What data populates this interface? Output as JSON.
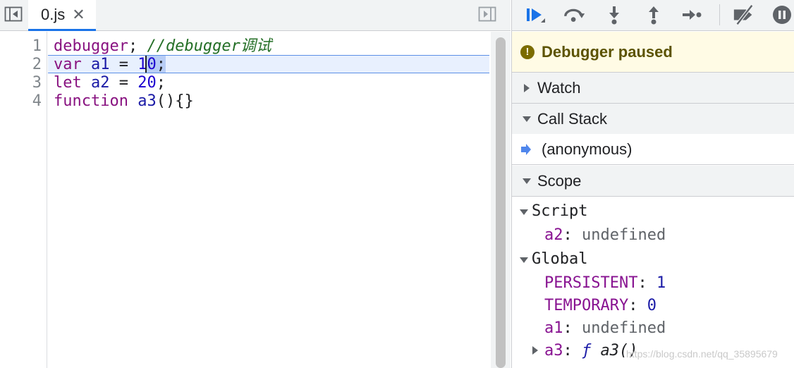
{
  "editor": {
    "tab": {
      "name": "0.js",
      "close": "✕"
    },
    "line_numbers": [
      "1",
      "2",
      "3",
      "4"
    ],
    "lines": [
      {
        "keyword": "debugger",
        "punct": ";",
        "comment": " //debugger调试"
      },
      {
        "keyword": "var",
        "ident": "a1",
        "op": "=",
        "value": "10",
        "end": ";"
      },
      {
        "keyword": "let",
        "ident": "a2",
        "op": "=",
        "value": "20",
        "end": ";"
      },
      {
        "keyword": "function",
        "ident": "a3",
        "rest": "(){}"
      }
    ]
  },
  "sidebar": {
    "toolbar": {
      "resume": "resume-icon",
      "step_over": "step-over-icon",
      "step_into": "step-into-icon",
      "step_out": "step-out-icon",
      "step": "step-icon",
      "deactivate": "deactivate-breakpoints-icon",
      "pause_exceptions": "pause-on-exceptions-icon"
    },
    "banner": {
      "icon": "!",
      "text": "Debugger paused"
    },
    "watch": {
      "label": "Watch"
    },
    "call_stack": {
      "label": "Call Stack",
      "frames": [
        {
          "name": "(anonymous)"
        }
      ]
    },
    "scope": {
      "label": "Scope",
      "groups": [
        {
          "name": "Script",
          "props": [
            {
              "key": "a2",
              "value": "undefined"
            }
          ]
        },
        {
          "name": "Global",
          "props": [
            {
              "key": "PERSISTENT",
              "value": "1"
            },
            {
              "key": "TEMPORARY",
              "value": "0"
            },
            {
              "key": "a1",
              "value": "undefined"
            },
            {
              "key": "a3",
              "value_prefix": "ƒ",
              "value": "a3()"
            }
          ]
        }
      ]
    }
  },
  "watermark": "https://blog.csdn.net/qq_35895679",
  "colors": {
    "accent": "#1a73e8",
    "keyword": "#881280",
    "identifier": "#1a1aa6",
    "comment": "#236e25",
    "paused_bg": "#fffbe5"
  }
}
